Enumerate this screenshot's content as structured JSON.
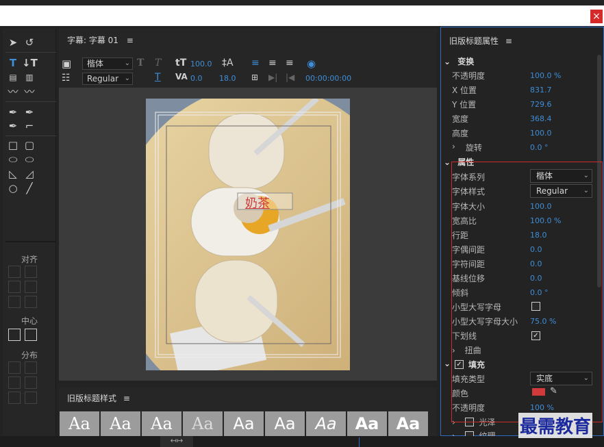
{
  "window": {
    "close_glyph": "×"
  },
  "tools": {
    "align_label": "对齐",
    "center_label": "中心",
    "distribute_label": "分布"
  },
  "tab": {
    "title": "字幕: 字幕 01",
    "menu_glyph": "≡"
  },
  "toolbar": {
    "font_family": "楷体",
    "font_style": "Regular",
    "font_size": "100.0",
    "kerning": "0.0",
    "leading": "18.0",
    "timecode": "00:00:00:00"
  },
  "canvas": {
    "title_text": "奶茶"
  },
  "styles_panel": {
    "title": "旧版标题样式",
    "menu_glyph": "≡",
    "swatch_text": "Aa",
    "swatch_count": 9
  },
  "props": {
    "title": "旧版标题属性",
    "menu_glyph": "≡",
    "transform": {
      "header": "变换",
      "rows": [
        {
          "label": "不透明度",
          "value": "100.0 %"
        },
        {
          "label": "X 位置",
          "value": "831.7"
        },
        {
          "label": "Y 位置",
          "value": "729.6"
        },
        {
          "label": "宽度",
          "value": "368.4"
        },
        {
          "label": "高度",
          "value": "100.0"
        },
        {
          "label": "旋转",
          "value": "0.0 °"
        }
      ]
    },
    "properties": {
      "header": "属性",
      "font_family_label": "字体系列",
      "font_family_value": "楷体",
      "font_style_label": "字体样式",
      "font_style_value": "Regular",
      "rows": [
        {
          "label": "字体大小",
          "value": "100.0"
        },
        {
          "label": "宽高比",
          "value": "100.0 %"
        },
        {
          "label": "行距",
          "value": "18.0"
        },
        {
          "label": "字偶间距",
          "value": "0.0"
        },
        {
          "label": "字符间距",
          "value": "0.0"
        },
        {
          "label": "基线位移",
          "value": "0.0"
        },
        {
          "label": "倾斜",
          "value": "0.0 °"
        }
      ],
      "small_caps_label": "小型大写字母",
      "small_caps_checked": false,
      "small_caps_size_label": "小型大写字母大小",
      "small_caps_size_value": "75.0 %",
      "underline_label": "下划线",
      "underline_checked": true,
      "distort_label": "扭曲"
    },
    "fill": {
      "header": "填充",
      "checked": true,
      "type_label": "填充类型",
      "type_value": "实底",
      "color_label": "颜色",
      "color_value": "#d03a3a",
      "opacity_label": "不透明度",
      "opacity_value": "100 %",
      "sheen_label": "光泽",
      "texture_label": "纹理"
    }
  },
  "watermark": "最需教育"
}
